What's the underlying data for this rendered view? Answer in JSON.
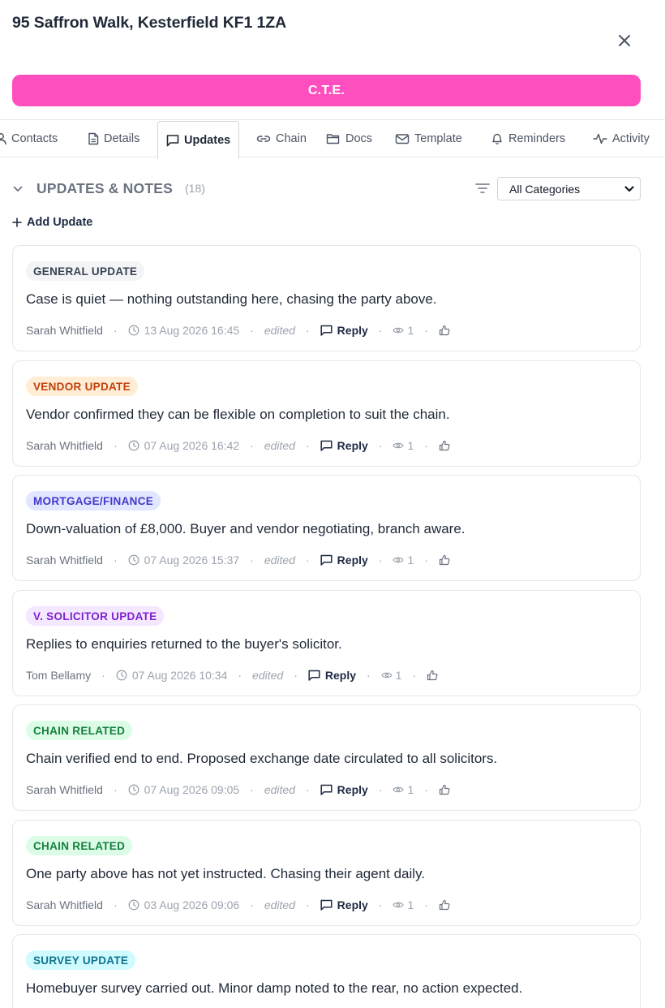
{
  "header": {
    "title": "95 Saffron Walk, Kesterfield KF1 1ZA"
  },
  "status": {
    "label": "C.T.E.",
    "color": "#ff4fbe"
  },
  "tabs": [
    {
      "label": "Contacts",
      "icon": "user-icon"
    },
    {
      "label": "Details",
      "icon": "document-icon"
    },
    {
      "label": "Updates",
      "icon": "message-square-icon",
      "active": true
    },
    {
      "label": "Chain",
      "icon": "link-icon"
    },
    {
      "label": "Docs",
      "icon": "folder-icon"
    },
    {
      "label": "Template",
      "icon": "mail-icon"
    },
    {
      "label": "Reminders",
      "icon": "bell-icon"
    },
    {
      "label": "Activity",
      "icon": "activity-icon"
    }
  ],
  "section": {
    "title": "UPDATES & NOTES",
    "count": "(18)",
    "filter": {
      "selected": "All Categories"
    },
    "add_label": "Add Update"
  },
  "meta_labels": {
    "edited": "edited",
    "reply": "Reply"
  },
  "updates": [
    {
      "category": "GENERAL UPDATE",
      "badge_bg": "#f3f4f6",
      "badge_fg": "#374151",
      "text": "Case is quiet — nothing outstanding here, chasing the party above.",
      "author": "Sarah Whitfield",
      "timestamp": "13 Aug 2026 16:45",
      "views": "1"
    },
    {
      "category": "VENDOR UPDATE",
      "badge_bg": "#ffedd5",
      "badge_fg": "#c2410c",
      "text": "Vendor confirmed they can be flexible on completion to suit the chain.",
      "author": "Sarah Whitfield",
      "timestamp": "07 Aug 2026 16:42",
      "views": "1"
    },
    {
      "category": "MORTGAGE/FINANCE",
      "badge_bg": "#e0e7ff",
      "badge_fg": "#4338ca",
      "text": "Down-valuation of £8,000. Buyer and vendor negotiating, branch aware.",
      "author": "Sarah Whitfield",
      "timestamp": "07 Aug 2026 15:37",
      "views": "1"
    },
    {
      "category": "V. SOLICITOR UPDATE",
      "badge_bg": "#f3e8ff",
      "badge_fg": "#7e22ce",
      "text": "Replies to enquiries returned to the buyer's solicitor.",
      "author": "Tom Bellamy",
      "timestamp": "07 Aug 2026 10:34",
      "views": "1"
    },
    {
      "category": "CHAIN RELATED",
      "badge_bg": "#dcfce7",
      "badge_fg": "#15803d",
      "text": "Chain verified end to end. Proposed exchange date circulated to all solicitors.",
      "author": "Sarah Whitfield",
      "timestamp": "07 Aug 2026 09:05",
      "views": "1"
    },
    {
      "category": "CHAIN RELATED",
      "badge_bg": "#dcfce7",
      "badge_fg": "#15803d",
      "text": "One party above has not yet instructed. Chasing their agent daily.",
      "author": "Sarah Whitfield",
      "timestamp": "03 Aug 2026 09:06",
      "views": "1"
    },
    {
      "category": "SURVEY UPDATE",
      "badge_bg": "#cffafe",
      "badge_fg": "#0e7490",
      "text": "Homebuyer survey carried out. Minor damp noted to the rear, no action expected.",
      "author": "",
      "timestamp": "",
      "views": ""
    }
  ]
}
